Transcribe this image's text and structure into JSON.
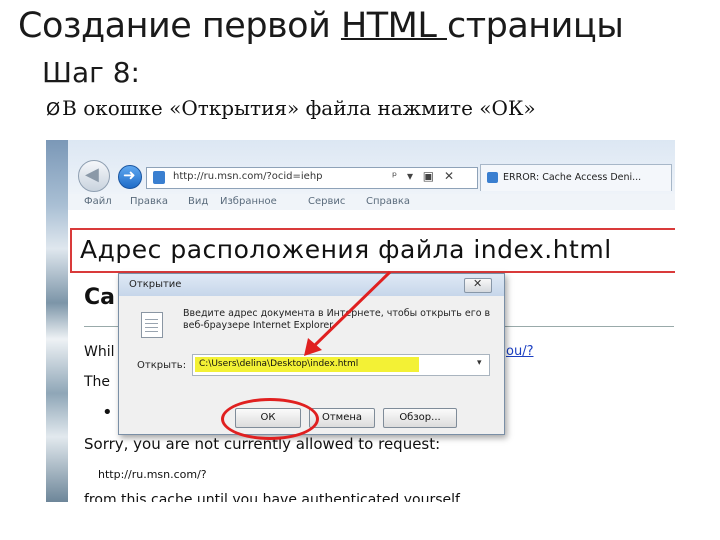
{
  "slide": {
    "title_before": "Создание первой ",
    "title_underlined": "HTML ",
    "title_after": "страницы",
    "step": "Шаг 8:",
    "bullet_mark": "Ø",
    "bullet": "В окошке «Открытия» файла нажмите «ОК»"
  },
  "browser": {
    "address": "http://ru.msn.com/?ocid=iehp",
    "address_tools": "ᵖ ▾ ▣ ✕",
    "tab_title": "ERROR: Cache Access Deni...",
    "menu": [
      "Файл",
      "Правка",
      "Вид",
      "Избранное",
      "Сервис",
      "Справка"
    ],
    "colors": {
      "nav_bg": "#dce7f3",
      "highlight": "#f3f135",
      "annotation_red": "#e02020"
    }
  },
  "annotation": {
    "header": "Адрес расположения файла index.html"
  },
  "background_page": {
    "heading": "Ca",
    "while_text": "Whil",
    "link_text": "ou/?",
    "the_text": "The",
    "bullet_dot": "•",
    "sorry": "Sorry, you are not currently allowed to request:",
    "url": "http://ru.msn.com/?",
    "from_line": "from this cache until you have authenticated yourself"
  },
  "dialog": {
    "title": "Открытие",
    "close_glyph": "✕",
    "description": "Введите адрес документа в Интернете, чтобы открыть его в веб-браузере Internet Explorer.",
    "input_label": "Открыть:",
    "input_value": "C:\\Users\\delina\\Desktop\\index.html",
    "dropdown_glyph": "▾",
    "ok": "ОК",
    "cancel": "Отмена",
    "browse": "Обзор..."
  }
}
